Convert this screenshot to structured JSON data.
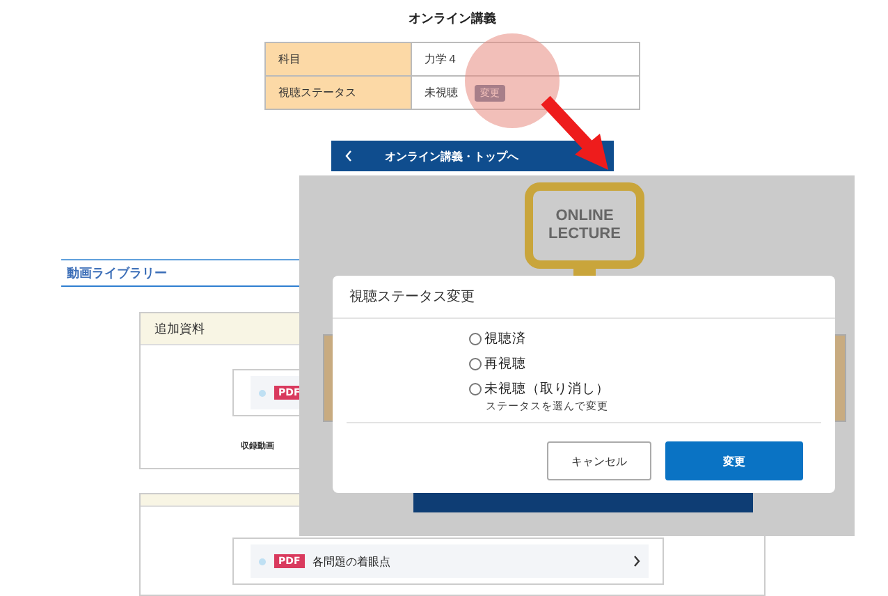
{
  "page_title": "オンライン講義",
  "info_table": {
    "rows": [
      {
        "label": "科目",
        "value": "力学４"
      },
      {
        "label": "視聴ステータス",
        "value": "未視聴",
        "button": "変更"
      }
    ]
  },
  "back_button": {
    "label": "オンライン講義・トップへ"
  },
  "section_title": "動画ライブラリー",
  "cards": [
    {
      "header": "追加資料",
      "item": {
        "badge": "PDF"
      },
      "note": "収録動画"
    },
    {
      "item": {
        "badge": "PDF",
        "label": "各問題の着眼点"
      }
    }
  ],
  "overlay": {
    "logo_lines": [
      "ONLINE",
      "LECTURE"
    ],
    "dialog": {
      "title": "視聴ステータス変更",
      "options": [
        {
          "label": "視聴済",
          "selected": false
        },
        {
          "label": "再視聴",
          "selected": false
        },
        {
          "label": "未視聴（取り消し）",
          "selected": false
        }
      ],
      "hint": "ステータスを選んで変更",
      "buttons": [
        {
          "label": "キャンセル",
          "kind": "secondary"
        },
        {
          "label": "変更",
          "kind": "primary"
        }
      ]
    }
  }
}
